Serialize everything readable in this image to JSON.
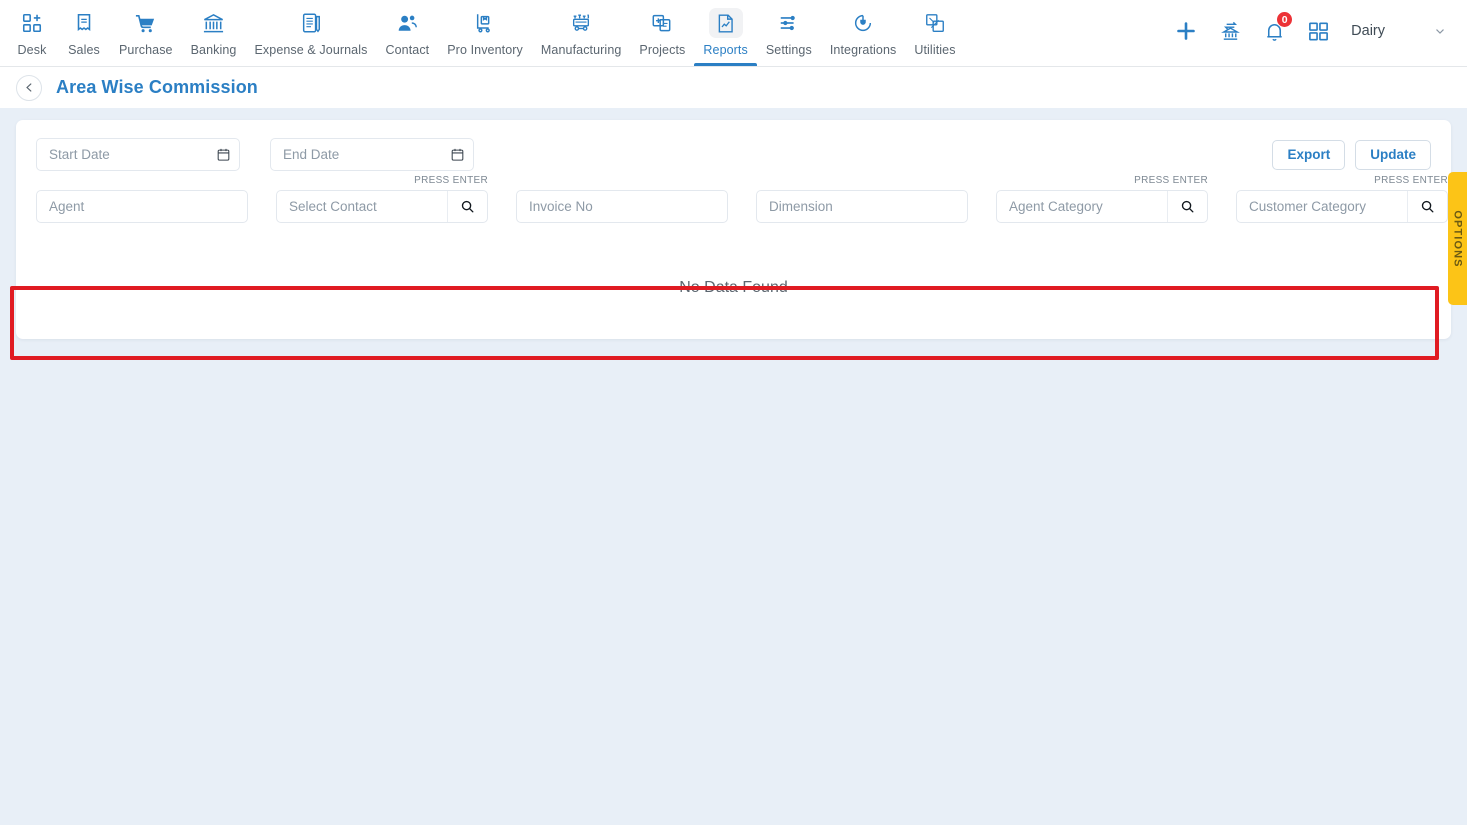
{
  "nav": {
    "items": [
      {
        "label": "Desk",
        "icon": "desk-grid-plus-icon",
        "active": false
      },
      {
        "label": "Sales",
        "icon": "sales-receipt-icon",
        "active": false
      },
      {
        "label": "Purchase",
        "icon": "purchase-cart-icon",
        "active": false
      },
      {
        "label": "Banking",
        "icon": "banking-bank-icon",
        "active": false
      },
      {
        "label": "Expense & Journals",
        "icon": "expense-journal-book-icon",
        "active": false
      },
      {
        "label": "Contact",
        "icon": "contact-people-icon",
        "active": false
      },
      {
        "label": "Pro Inventory",
        "icon": "pro-inventory-trolley-icon",
        "active": false
      },
      {
        "label": "Manufacturing",
        "icon": "manufacturing-machine-icon",
        "active": false
      },
      {
        "label": "Projects",
        "icon": "projects-clipboard-icon",
        "active": false
      },
      {
        "label": "Reports",
        "icon": "reports-chart-document-icon",
        "active": true
      },
      {
        "label": "Settings",
        "icon": "settings-sliders-icon",
        "active": false
      },
      {
        "label": "Integrations",
        "icon": "integrations-plug-icon",
        "active": false
      },
      {
        "label": "Utilities",
        "icon": "utilities-transform-icon",
        "active": false
      }
    ],
    "right": {
      "add_icon": "plus-icon",
      "transfer_icon": "bank-transfer-icon",
      "notification_icon": "bell-icon",
      "notification_count": "0",
      "apps_icon": "apps-grid-icon",
      "org_name": "Dairy",
      "org_caret_icon": "chevron-down-icon"
    }
  },
  "header": {
    "back_icon": "chevron-left-icon",
    "title": "Area Wise Commission"
  },
  "filters": {
    "start_date": {
      "placeholder": "Start Date",
      "value": "",
      "icon": "calendar-icon"
    },
    "end_date": {
      "placeholder": "End Date",
      "value": "",
      "icon": "calendar-icon"
    },
    "agent": {
      "placeholder": "Agent",
      "value": ""
    },
    "contact": {
      "placeholder": "Select Contact",
      "value": "",
      "hint": "PRESS ENTER",
      "icon": "search-icon"
    },
    "invoice_no": {
      "placeholder": "Invoice No",
      "value": ""
    },
    "dimension": {
      "placeholder": "Dimension",
      "value": ""
    },
    "agent_category": {
      "placeholder": "Agent Category",
      "value": "",
      "hint": "PRESS ENTER",
      "icon": "search-icon"
    },
    "customer_category": {
      "placeholder": "Customer Category",
      "value": "",
      "hint": "PRESS ENTER",
      "icon": "search-icon"
    }
  },
  "actions": {
    "export_label": "Export",
    "update_label": "Update"
  },
  "main": {
    "empty_message": "No Data Found"
  },
  "options_tab": {
    "label": "OPTIONS"
  },
  "colors": {
    "accent_blue": "#2b7fc4",
    "highlight_red": "#e01b22",
    "options_yellow": "#fcc417",
    "badge_red": "#ec3237",
    "page_bg": "#e8eff7"
  }
}
